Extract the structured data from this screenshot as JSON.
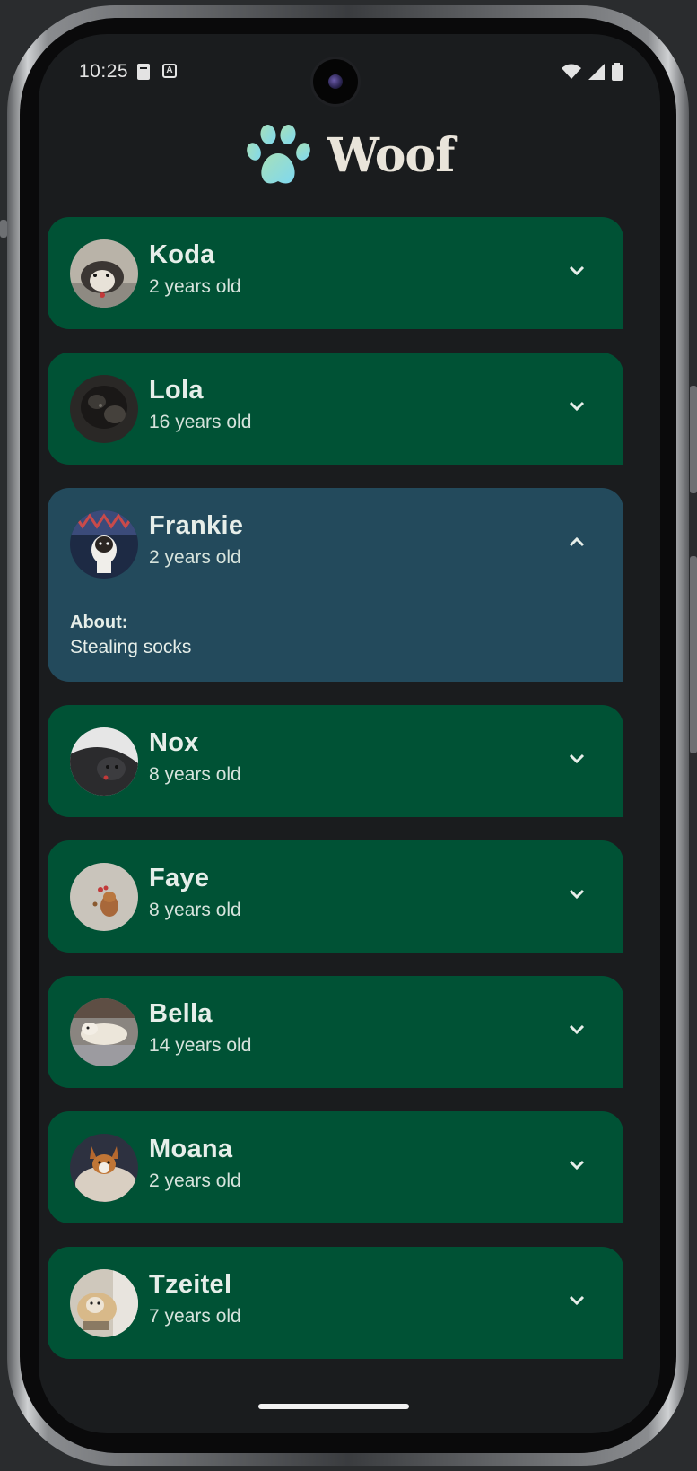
{
  "status_bar": {
    "time": "10:25",
    "icons": [
      "sim-card-icon",
      "accessibility-icon",
      "wifi-icon",
      "signal-icon",
      "battery-icon"
    ]
  },
  "app": {
    "title": "Woof",
    "logo_icon": "paw-icon"
  },
  "dogs": [
    {
      "name": "Koda",
      "age": "2 years old",
      "expanded": false
    },
    {
      "name": "Lola",
      "age": "16 years old",
      "expanded": false
    },
    {
      "name": "Frankie",
      "age": "2 years old",
      "expanded": true,
      "about_label": "About:",
      "about_text": "Stealing socks"
    },
    {
      "name": "Nox",
      "age": "8 years old",
      "expanded": false
    },
    {
      "name": "Faye",
      "age": "8 years old",
      "expanded": false
    },
    {
      "name": "Bella",
      "age": "14 years old",
      "expanded": false
    },
    {
      "name": "Moana",
      "age": "2 years old",
      "expanded": false
    },
    {
      "name": "Tzeitel",
      "age": "7 years old",
      "expanded": false
    }
  ],
  "colors": {
    "card": "#005235",
    "card_expanded": "#234a5c",
    "background": "#1a1c1e"
  }
}
